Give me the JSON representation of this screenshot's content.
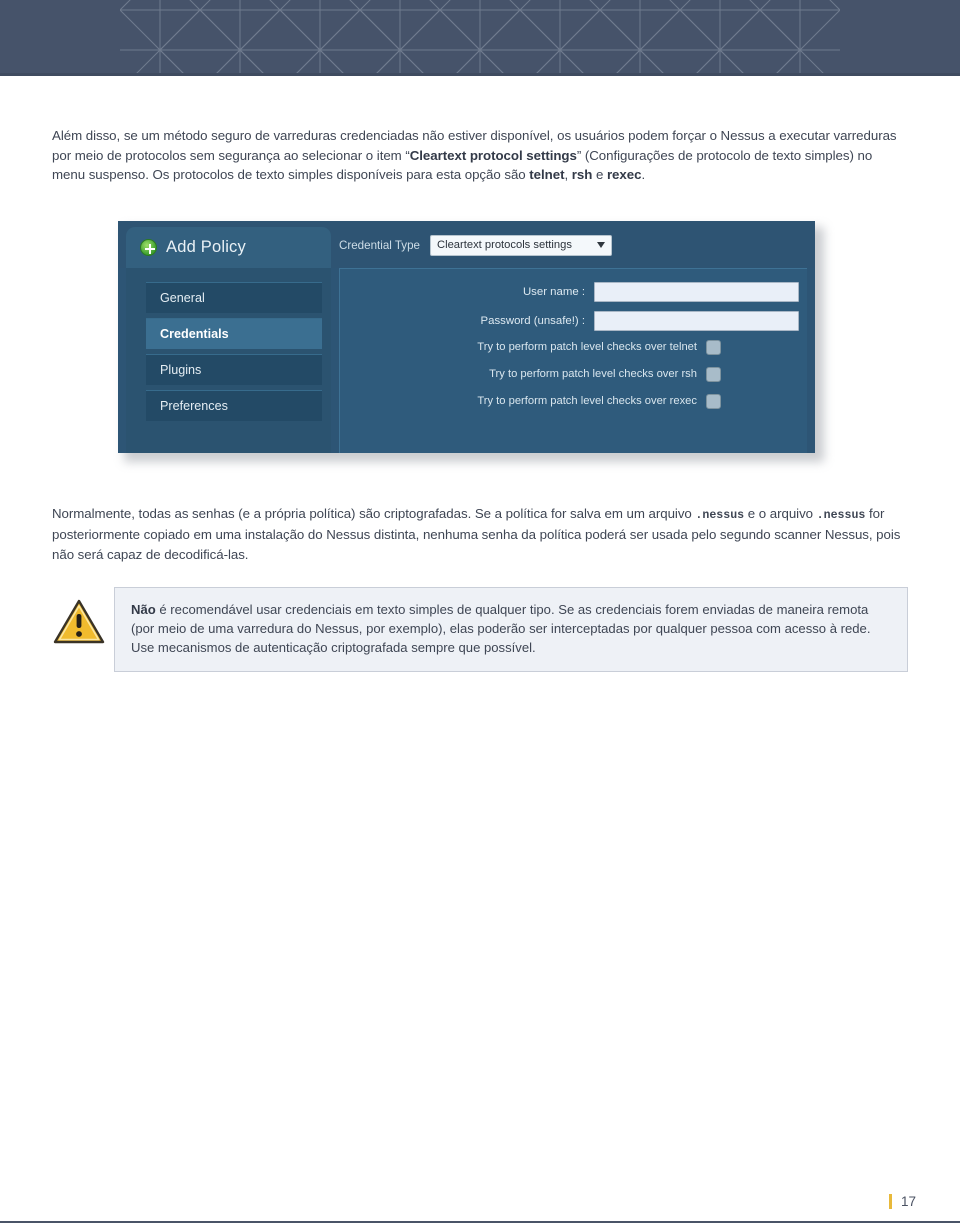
{
  "header": {
    "pattern_name": "isometric-line-pattern",
    "background_color": "#46536a"
  },
  "paragraphs": {
    "intro": {
      "segment_1": "Além disso, se um método seguro de varreduras credenciadas não estiver disponível, os usuários podem forçar o Nessus a executar varreduras por meio de protocolos sem segurança ao selecionar o item “",
      "bold_1": "Cleartext protocol settings",
      "segment_2": "” (Configurações de protocolo de texto simples) no menu suspenso. Os protocolos de texto simples disponíveis para esta opção são ",
      "bold_2": "telnet",
      "segment_3": ", ",
      "bold_3": "rsh",
      "segment_4": " e ",
      "bold_4": "rexec",
      "segment_5": "."
    },
    "encryption": {
      "segment_1": "Normalmente, todas as senhas (e a própria política) são criptografadas. Se a política for salva em um arquivo ",
      "mono_1": ".nessus",
      "segment_2": " e o arquivo ",
      "mono_2": ".nessus",
      "segment_3": " for posteriormente copiado em uma instalação do Nessus distinta, nenhuma senha da política poderá ser usada pelo segundo scanner Nessus, pois não será capaz de decodificá-las."
    }
  },
  "screenshot": {
    "title": "Add Policy",
    "title_icon": "add-circle-icon",
    "credential_type_label": "Credential Type",
    "credential_type_value": "Cleartext protocols settings",
    "dropdown_icon": "chevron-down-icon",
    "sidebar": [
      {
        "label": "General",
        "selected": false
      },
      {
        "label": "Credentials",
        "selected": true
      },
      {
        "label": "Plugins",
        "selected": false
      },
      {
        "label": "Preferences",
        "selected": false
      }
    ],
    "fields": [
      {
        "label": "User name :",
        "value": ""
      },
      {
        "label": "Password (unsafe!) :",
        "value": ""
      }
    ],
    "checkboxes": [
      {
        "label": "Try to perform patch level checks over telnet",
        "checked": false
      },
      {
        "label": "Try to perform patch level checks over rsh",
        "checked": false
      },
      {
        "label": "Try to perform patch level checks over rexec",
        "checked": false
      }
    ]
  },
  "callout": {
    "icon": "warning-triangle-icon",
    "bold_lead": "Não",
    "body": " é recomendável usar credenciais em texto simples de qualquer tipo. Se as credenciais forem enviadas de maneira remota (por meio de uma varredura do Nessus, por exemplo), elas poderão ser interceptadas por qualquer pessoa com acesso à rede. Use mecanismos de autenticação criptografada sempre que possível.",
    "background_color": "#eef1f6",
    "border_color": "#c9ced8"
  },
  "footer": {
    "page_number": "17",
    "accent_color": "#e8b93b"
  }
}
